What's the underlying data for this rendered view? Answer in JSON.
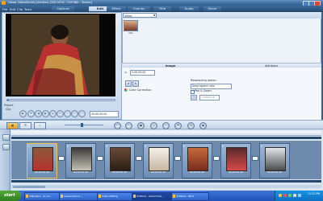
{
  "window": {
    "title": "Ulead VideoStudio [Untitled, DVD NTSC 720*480 - Stereo]",
    "controls": [
      "minimize",
      "maximize",
      "close"
    ]
  },
  "menu": {
    "items": [
      "File",
      "Edit",
      "Clip",
      "Tools"
    ]
  },
  "tabs": [
    {
      "label": "Capture",
      "active": false
    },
    {
      "label": "Edit",
      "active": true
    },
    {
      "label": "Effect",
      "active": false
    },
    {
      "label": "Overlay",
      "active": false
    },
    {
      "label": "Title",
      "active": false
    },
    {
      "label": "Audio",
      "active": false
    },
    {
      "label": "Share",
      "active": false
    }
  ],
  "preview": {
    "mode_label": "Project",
    "mode_label2": "Clip",
    "timecode": "00:00:00:00",
    "progress": 0.0
  },
  "library": {
    "category": "Video",
    "thumb_label": "V01"
  },
  "options": {
    "tabs": [
      "Image",
      "Attribute"
    ],
    "active_tab": "Image",
    "duration": "0:00:03:00",
    "color_correction_label": "Color Correction",
    "resampling_label": "Resampling option:",
    "resampling_value": "Keep aspect ratio",
    "pan_zoom_label": "Pan & Zoom",
    "customize_label": "Customize"
  },
  "timeline": {
    "clips": [
      {
        "index": "1",
        "time": "00:00:03:00"
      },
      {
        "index": "2",
        "time": "00:00:03:00"
      },
      {
        "index": "3",
        "time": "00:00:03:00"
      },
      {
        "index": "4",
        "time": "00:00:03:00"
      },
      {
        "index": "5",
        "time": "00:00:03:00"
      },
      {
        "index": "6",
        "time": "00:00:03:00"
      },
      {
        "index": "7",
        "time": "00:00:03:00"
      }
    ]
  },
  "taskbar": {
    "start_label": "start",
    "tasks": [
      "mBanjara - an ex...",
      "appsenaire.in...",
      "Video Editing",
      "Untitled - Ulead Vide...",
      "Untitled - Paint"
    ],
    "clock": "11:12 PM"
  },
  "colors": {
    "accent": "#2f5d8c",
    "active_tab": "#dfe9f5",
    "start_green": "#3f9a2b",
    "taskbar_blue": "#2d63c9"
  }
}
